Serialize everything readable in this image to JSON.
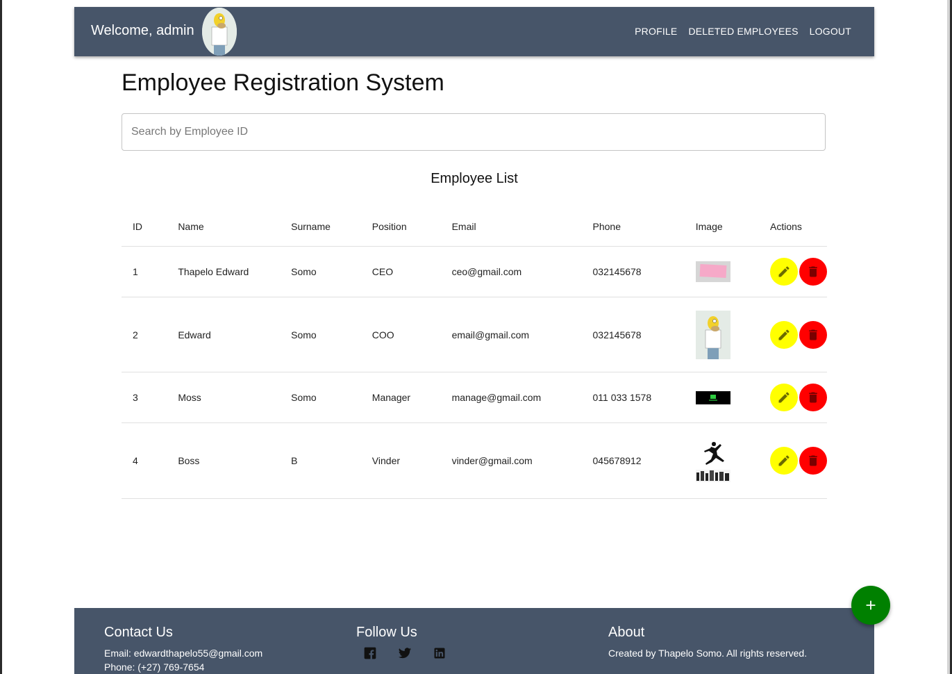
{
  "navbar": {
    "welcome": "Welcome, admin",
    "links": [
      "PROFILE",
      "DELETED EMPLOYEES",
      "LOGOUT"
    ]
  },
  "page": {
    "title": "Employee Registration System",
    "search_placeholder": "Search by Employee ID",
    "list_title": "Employee List"
  },
  "table": {
    "headers": [
      "ID",
      "Name",
      "Surname",
      "Position",
      "Email",
      "Phone",
      "Image",
      "Actions"
    ],
    "rows": [
      {
        "id": "1",
        "name": "Thapelo Edward",
        "surname": "Somo",
        "position": "CEO",
        "email": "ceo@gmail.com",
        "phone": "032145678"
      },
      {
        "id": "2",
        "name": "Edward",
        "surname": "Somo",
        "position": "COO",
        "email": "email@gmail.com",
        "phone": "032145678"
      },
      {
        "id": "3",
        "name": "Moss",
        "surname": "Somo",
        "position": "Manager",
        "email": "manage@gmail.com",
        "phone": "011 033 1578"
      },
      {
        "id": "4",
        "name": "Boss",
        "surname": "B",
        "position": "Vinder",
        "email": "vinder@gmail.com",
        "phone": "045678912"
      }
    ]
  },
  "footer": {
    "contact_title": "Contact Us",
    "contact_email": "Email: edwardthapelo55@gmail.com",
    "contact_phone": "Phone: (+27) 769-7654",
    "follow_title": "Follow Us",
    "about_title": "About",
    "about_text": "Created by Thapelo Somo. All rights reserved."
  },
  "icons": {
    "edit": "pencil-icon",
    "delete": "trash-icon",
    "add": "plus-icon",
    "social": [
      "facebook-icon",
      "twitter-icon",
      "linkedin-icon"
    ]
  },
  "colors": {
    "navbar": "#475569",
    "edit_button": "#ffff00",
    "delete_button": "#ff0000",
    "add_button": "#008000"
  }
}
